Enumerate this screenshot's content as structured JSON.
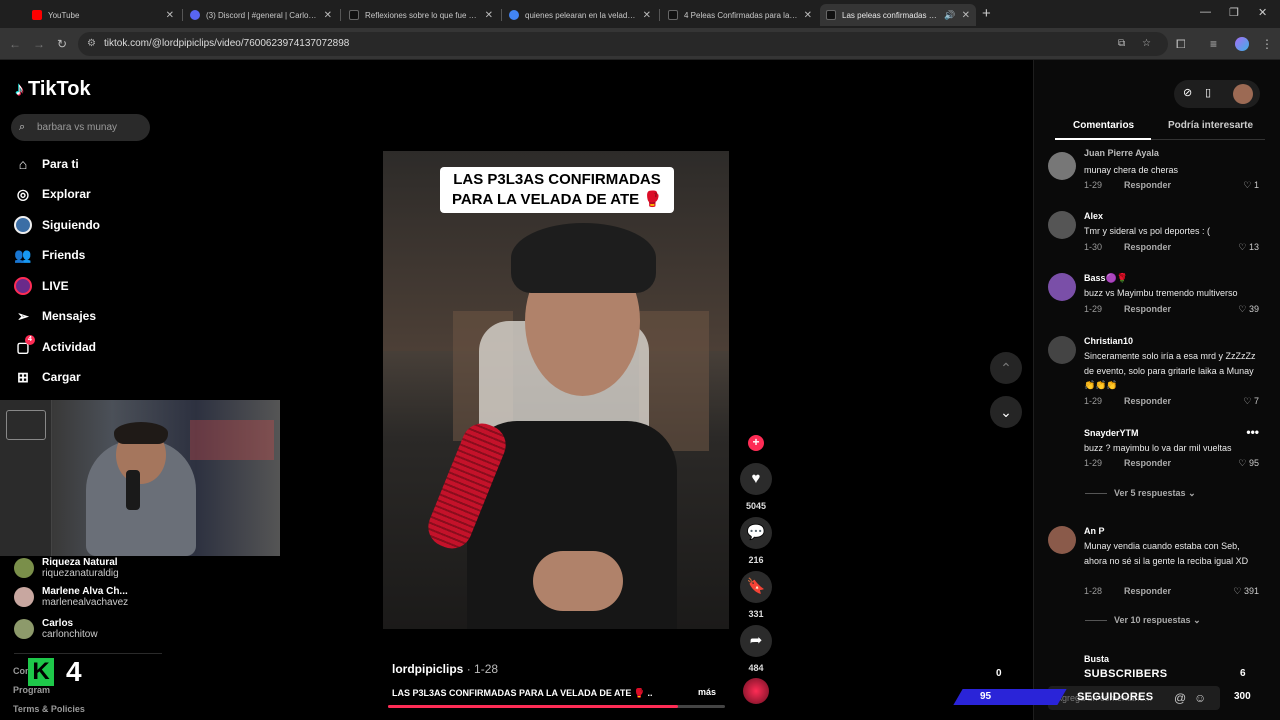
{
  "browser": {
    "tabs": [
      {
        "title": "YouTube",
        "fav": "#ff0000"
      },
      {
        "title": "(3) Discord | #general | Carlonch",
        "fav": "#5865f2"
      },
      {
        "title": "Reflexiones sobre lo que fue y q",
        "fav": "#111111"
      },
      {
        "title": "quienes pelearan en la velada d",
        "fav": "#4285f4"
      },
      {
        "title": "4 Peleas Confirmadas para la Ve",
        "fav": "#111111"
      },
      {
        "title": "Las peleas confirmadas par",
        "fav": "#111111"
      }
    ],
    "url": "tiktok.com/@lordpipiclips/video/7600623974137072898"
  },
  "tiktok": {
    "logo": "TikTok",
    "search_placeholder": "barbara vs munay",
    "nav": [
      {
        "label": "Para ti",
        "icon": "home-icon"
      },
      {
        "label": "Explorar",
        "icon": "compass-icon"
      },
      {
        "label": "Siguiendo",
        "icon": "following-icon"
      },
      {
        "label": "Friends",
        "icon": "friends-icon"
      },
      {
        "label": "LIVE",
        "icon": "live-icon"
      },
      {
        "label": "Mensajes",
        "icon": "send-icon"
      },
      {
        "label": "Actividad",
        "icon": "activity-icon",
        "badge": "4"
      },
      {
        "label": "Cargar",
        "icon": "plus-box-icon"
      }
    ],
    "following": [
      {
        "name": "Riqueza Natural",
        "handle": "riquezanaturaldig"
      },
      {
        "name": "Marlene Alva Ch...",
        "handle": "marlenealvachavez"
      },
      {
        "name": "Carlos",
        "handle": "carlonchitow"
      }
    ],
    "footer": {
      "company": "Company",
      "program": "Program",
      "terms": "Terms & Policies"
    },
    "video": {
      "caption_overlay": "LAS P3L3AS CONFIRMADAS PARA LA VELADA DE ATE 🥊",
      "author": "lordpipiclips",
      "date": "· 1-28",
      "description": "LAS P3L3AS CONFIRMADAS PARA LA VELADA DE ATE 🥊 ...",
      "more": "más",
      "likes": "5045",
      "comments": "216",
      "saves": "331",
      "shares": "484",
      "progress": 0.86
    },
    "panel": {
      "tab_comments": "Comentarios",
      "tab_interest": "Podría interesarte",
      "comments": [
        {
          "name": "Juan Pierre Ayala",
          "text": "munay chera de cheras",
          "date": "1-29",
          "reply": "Responder",
          "likes": "1"
        },
        {
          "name": "Alex",
          "text": "Tmr y sideral vs pol deportes : (",
          "date": "1-30",
          "reply": "Responder",
          "likes": "13"
        },
        {
          "name": "Bass🟣🌹",
          "text": "buzz vs Mayimbu tremendo multiverso",
          "date": "1-29",
          "reply": "Responder",
          "likes": "39"
        },
        {
          "name": "Christian10",
          "text": "Sinceramente solo iría a esa mrd y ZzZzZz de evento, solo para gritarle laika a Munay 👏👏👏",
          "date": "1-29",
          "reply": "Responder",
          "likes": "7"
        },
        {
          "name": "SnayderYTM",
          "text": "buzz ? mayimbu lo va dar mil vueltas",
          "date": "1-29",
          "reply": "Responder",
          "likes": "95",
          "replies": "Ver 5 respuestas"
        },
        {
          "name": "An P",
          "text": "Munay vendia cuando estaba con Seb, ahora no sé si la gente la reciba igual XD",
          "date": "1-28",
          "reply": "Responder",
          "likes": "391",
          "replies": "Ver 10 respuestas"
        },
        {
          "name": "Busta",
          "text": "",
          "date": "",
          "reply": "",
          "likes": ""
        }
      ],
      "add_comment_placeholder": "Agrega un comentario..."
    }
  },
  "stream_overlay": {
    "k_label": "K",
    "k_count": "4",
    "subscribers_label": "SUBSCRIBERS",
    "subscribers_left": "0",
    "subscribers_right": "6",
    "followers_label": "SEGUIDORES",
    "followers_left": "95",
    "followers_right": "300"
  }
}
